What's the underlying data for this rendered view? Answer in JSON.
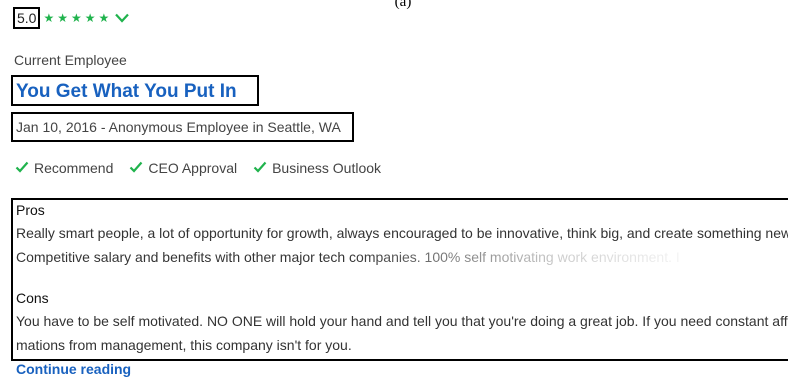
{
  "caption": "(a)",
  "review": {
    "rating": "5.0",
    "rating_stars": 5,
    "star_color": "#20b34d",
    "link_color": "#1861bf",
    "employee_status": "Current Employee",
    "title": "You Get What You Put In",
    "meta": "Jan 10, 2016 - Anonymous Employee in Seattle, WA",
    "approvals": [
      {
        "icon": "checkmark-icon",
        "label": "Recommend"
      },
      {
        "icon": "checkmark-icon",
        "label": "CEO Approval"
      },
      {
        "icon": "checkmark-icon",
        "label": "Business Outlook"
      }
    ],
    "pros": {
      "heading": "Pros",
      "lines": [
        "Really smart people, a lot of opportunity for growth, always encouraged to be innovative, think big, and create something new.",
        "Competitive salary and benefits with other major tech companies. 100% self motivating work environment. I"
      ]
    },
    "cons": {
      "heading": "Cons",
      "lines": [
        "You have to be self motivated. NO ONE will hold your hand and tell you that you're doing a great job. If you need constant affir",
        "mations from management, this company isn't for you."
      ]
    },
    "continue_label": "Continue reading"
  }
}
